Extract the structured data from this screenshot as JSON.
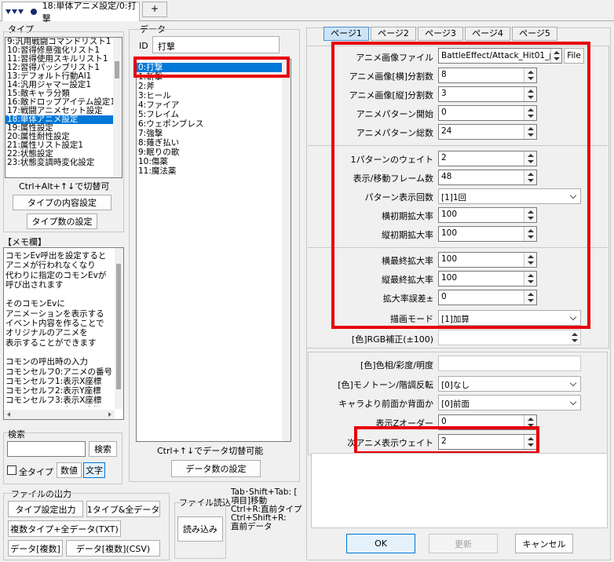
{
  "tab": {
    "title": "18:単体アニメ設定/0:打撃",
    "plus": "+"
  },
  "type_panel": {
    "heading": "タイプ",
    "items": [
      "9:汎用戦闘コマンドリスト1",
      "10:習得修意強化リスト1",
      "11:習得使用スキルリスト1",
      "12:習得パッシブリスト1",
      "13:デフォルト行動AI1",
      "14:汎用ジャマー設定1",
      "15:敵キャラ分類",
      "16:敵ドロップアイテム設定1",
      "17:戦闘アニメセット設定",
      "18:単体アニメ設定",
      "19:属性設定",
      "20:属性耐性設定",
      "21:属性リスト設定1",
      "22:状態設定",
      "23:状態変調時変化設定"
    ],
    "selected_index": 9,
    "hint": "Ctrl+Alt+↑↓で切替可",
    "btn_content": "タイプの内容設定",
    "btn_count": "タイプ数の設定"
  },
  "memo": {
    "heading": "【メモ欄】",
    "lines": [
      "コモンEv呼出を設定すると",
      "アニメが行われなくなり",
      "代わりに指定のコモンEvが",
      "呼び出されます",
      "",
      "そのコモンEvに",
      "アニメーションを表示する",
      "イベント内容を作ることで",
      "オリジナルのアニメを",
      "表示することができます",
      "",
      "コモンの呼出時の入力",
      "コモンセルフ0:アニメの番号",
      "コモンセルフ1:表示X座標",
      "コモンセルフ2:表示Y座標",
      "コモンセルフ3:表示X座標",
      "コモンセルフ4:表示Y座標"
    ]
  },
  "search": {
    "heading": "検索",
    "button": "検索",
    "all_types": "全タイプ",
    "numeric": "数値",
    "text": "文字"
  },
  "file_output": {
    "heading": "ファイルの出力",
    "btn1": "タイプ設定出力",
    "btn2": "1タイプ&全データ",
    "btn3": "複数タイプ+全データ(TXT)",
    "btn4": "データ[複数]",
    "btn5": "データ[複数](CSV)"
  },
  "file_read": {
    "heading": "ファイル読込",
    "button": "読み込み"
  },
  "shortcuts": {
    "lines": [
      "Tab･Shift+Tab:  [",
      "項目]移動",
      "Ctrl+R:直前タイプ",
      "Ctrl+Shift+R:",
      " 直前データ"
    ]
  },
  "data_panel": {
    "heading": "データ",
    "id_label": "ID",
    "id_value": "打撃",
    "items": [
      "0:打撃",
      "1:斬撃",
      "2:斧",
      "3:ヒール",
      "4:ファイア",
      "5:フレイム",
      "6:ウェポンブレス",
      "7:強撃",
      "8:薙ぎ払い",
      "9:眠りの歌",
      "10:傷薬",
      "11:魔法薬"
    ],
    "selected_index": 0,
    "hint": "Ctrl+↑↓でデータ切替可能",
    "btn_count": "データ数の設定"
  },
  "page_tabs": [
    "ページ1",
    "ページ2",
    "ページ3",
    "ページ4",
    "ページ5"
  ],
  "fields": {
    "anim_image_file": {
      "label": "アニメ画像ファイル",
      "value": "BattleEffect/Attack_Hit01_p",
      "button": "File"
    },
    "h_split": {
      "label": "アニメ画像[横]分割数",
      "value": "8"
    },
    "v_split": {
      "label": "アニメ画像[縦]分割数",
      "value": "3"
    },
    "pattern_start": {
      "label": "アニメパターン開始",
      "value": "0"
    },
    "pattern_total": {
      "label": "アニメパターン総数",
      "value": "24"
    },
    "pattern_wait": {
      "label": "1パターンのウェイト",
      "value": "2"
    },
    "move_frames": {
      "label": "表示/移動フレーム数",
      "value": "48"
    },
    "repeat": {
      "label": "パターン表示回数",
      "value": "[1]1回"
    },
    "init_scale_x": {
      "label": "横初期拡大率",
      "value": "100"
    },
    "init_scale_y": {
      "label": "縦初期拡大率",
      "value": "100"
    },
    "final_scale_x": {
      "label": "横最終拡大率",
      "value": "100"
    },
    "final_scale_y": {
      "label": "縦最終拡大率",
      "value": "100"
    },
    "scale_error": {
      "label": "拡大率誤差±",
      "value": "0"
    },
    "draw_mode": {
      "label": "描画モード",
      "value": "[1]加算"
    },
    "rgb": {
      "label": "[色]RGB補正(±100)",
      "value": ""
    },
    "hsv": {
      "label": "[色]色相/彩度/明度",
      "value": ""
    },
    "mono": {
      "label": "[色]モノトーン/階調反転",
      "value": "[0]なし"
    },
    "front_back": {
      "label": "キャラより前面か背面か",
      "value": "[0]前面"
    },
    "z_order": {
      "label": "表示Zオーダー",
      "value": "0"
    },
    "next_wait": {
      "label": "次アニメ表示ウェイト",
      "value": "2"
    }
  },
  "dialog": {
    "ok": "OK",
    "update": "更新",
    "cancel": "キャンセル"
  },
  "colors": {
    "highlight": "#e8000a",
    "selection": "#0078d7"
  }
}
